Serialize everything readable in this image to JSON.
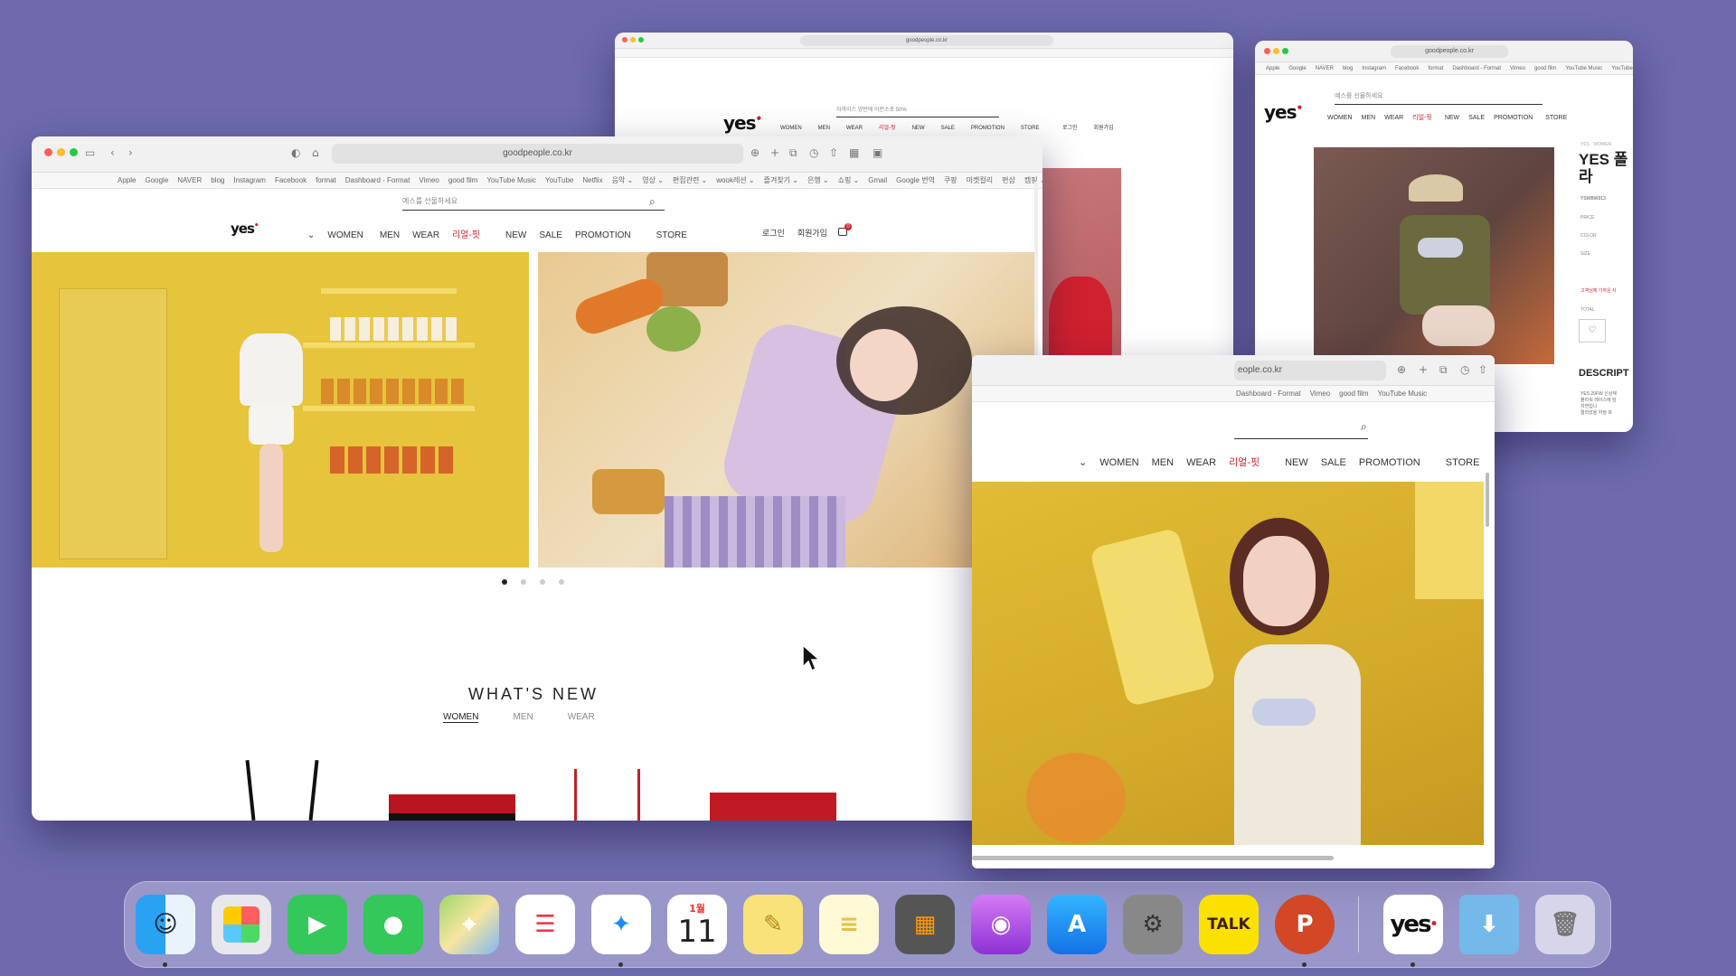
{
  "windows": {
    "main": {
      "url": "goodpeople.co.kr",
      "bookmarks": [
        "Apple",
        "Google",
        "NAVER",
        "blog",
        "Instagram",
        "Facebook",
        "format",
        "Dashboard - Format",
        "Vimeo",
        "good film",
        "YouTube Music",
        "YouTube",
        "Netflix",
        "음악 ⌄",
        "영상 ⌄",
        "편집관련 ⌄",
        "wook레션 ⌄",
        "즐겨찾기 ⌄",
        "은행 ⌄",
        "쇼핑 ⌄",
        "Gmail",
        "Google 번역",
        "쿠팡",
        "마켓컬리",
        "편샵",
        "캠핑 ⌄"
      ],
      "search_placeholder": "예스를 선물하세요",
      "logo": "yes",
      "nav": {
        "dropdown": "⌄",
        "women": "WOMEN",
        "men": "MEN",
        "wear": "WEAR",
        "special": "리얼-핏",
        "new": "NEW",
        "sale": "SALE",
        "promotion": "PROMOTION",
        "store": "STORE"
      },
      "login": "로그인",
      "signup": "회원가입",
      "cart_count": "0",
      "section_title": "WHAT'S NEW",
      "tabs": [
        "WOMEN",
        "MEN",
        "WEAR"
      ]
    },
    "back1": {
      "url": "goodpeople.co.kr",
      "search_placeholder": "자까이스 양반에 이런소로 50%",
      "nav": [
        "WOMEN",
        "MEN",
        "WEAR",
        "리얼-핏",
        "NEW",
        "SALE",
        "PROMOTION",
        "STORE"
      ],
      "login": "로그인",
      "signup": "회원가입"
    },
    "back2": {
      "url": "goodpeople.co.kr",
      "bookmarks": [
        "Apple",
        "Google",
        "NAVER",
        "blog",
        "Instagram",
        "Facebook",
        "format",
        "Dashboard - Format",
        "Vimeo",
        "good film",
        "YouTube Music",
        "YouTube"
      ],
      "search_placeholder": "예스를 선물하세요",
      "logo": "yes",
      "nav": [
        "WOMEN",
        "MEN",
        "WEAR",
        "리얼-핏",
        "NEW",
        "SALE",
        "PROMOTION",
        "STORE"
      ],
      "product": {
        "crumb": "YES · WOMEN",
        "title": "YES 폴라",
        "code": "YSWBW913",
        "labels": [
          "PRICE",
          "COLOR",
          "SIZE"
        ],
        "notice": "고객님께 가까운 사",
        "total": "TOTAL",
        "desc": "DESCRIPT",
        "desc_text": [
          "YES 20FW 신상체",
          "플라워 레이스에 담",
          "자연입니",
          "절리았을 자정 흐"
        ]
      }
    },
    "front": {
      "url": "eople.co.kr",
      "bookmarks": [
        "Dashboard - Format",
        "Vimeo",
        "good film",
        "YouTube Music"
      ],
      "nav": [
        "⌄",
        "WOMEN",
        "MEN",
        "WEAR",
        "리얼-핏",
        "NEW",
        "SALE",
        "PROMOTION",
        "STORE"
      ]
    }
  },
  "dock": {
    "calendar_month": "1월",
    "calendar_day": "11",
    "kakao": "TALK",
    "ppt": "P",
    "yes": "yes"
  },
  "colors": {
    "brand_red": "#d0212e",
    "yellow": "#e9c23a",
    "desktop": "#6e6aad"
  }
}
